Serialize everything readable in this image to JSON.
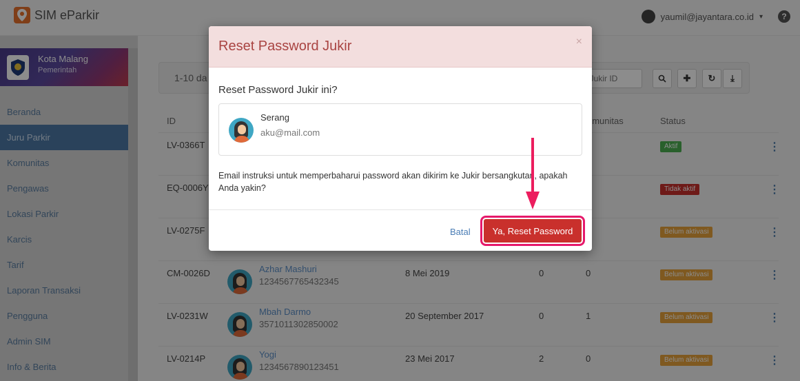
{
  "app": {
    "title": "SIM eParkir"
  },
  "user": {
    "email": "yaumil@jayantara.co.id"
  },
  "org": {
    "name": "Kota Malang",
    "subtitle": "Pemerintah"
  },
  "sidebar": {
    "items": [
      {
        "label": "Beranda"
      },
      {
        "label": "Juru Parkir",
        "active": true
      },
      {
        "label": "Komunitas"
      },
      {
        "label": "Pengawas"
      },
      {
        "label": "Lokasi Parkir"
      },
      {
        "label": "Karcis"
      },
      {
        "label": "Tarif"
      },
      {
        "label": "Laporan Transaksi"
      },
      {
        "label": "Pengguna"
      },
      {
        "label": "Admin SIM"
      },
      {
        "label": "Info & Berita"
      }
    ]
  },
  "toolbar": {
    "count_label": "1-10 da",
    "search_placeholder": "/ Jukir ID",
    "search_icon": "search-icon",
    "add_icon": "plus-icon",
    "refresh_icon": "refresh-icon",
    "download_icon": "download-icon"
  },
  "table": {
    "headers": {
      "id": "ID",
      "komunitas": "omunitas",
      "status": "Status"
    },
    "rows": [
      {
        "id": "LV-0366T",
        "name": "",
        "phone": "",
        "date": "",
        "n1": "",
        "n2": "",
        "status": "Aktif",
        "status_type": "aktif"
      },
      {
        "id": "EQ-0006Y",
        "name": "",
        "phone": "",
        "date": "",
        "n1": "",
        "n2": "",
        "status": "Tidak aktif",
        "status_type": "tidak"
      },
      {
        "id": "LV-0275F",
        "name": "",
        "phone": "",
        "date": "",
        "n1": "",
        "n2": "",
        "status": "Belum aktivasi",
        "status_type": "belum"
      },
      {
        "id": "CM-0026D",
        "name": "Azhar Mashuri",
        "phone": "1234567765432345",
        "date": "8 Mei 2019",
        "n1": "0",
        "n2": "0",
        "status": "Belum aktivasi",
        "status_type": "belum"
      },
      {
        "id": "LV-0231W",
        "name": "Mbah Darmo",
        "phone": "3571011302850002",
        "date": "20 September 2017",
        "n1": "0",
        "n2": "1",
        "status": "Belum aktivasi",
        "status_type": "belum"
      },
      {
        "id": "LV-0214P",
        "name": "Yogi",
        "phone": "1234567890123451",
        "date": "23 Mei 2017",
        "n1": "2",
        "n2": "0",
        "status": "Belum aktivasi",
        "status_type": "belum"
      }
    ]
  },
  "modal": {
    "title": "Reset Password Jukir",
    "close": "×",
    "question": "Reset Password Jukir ini?",
    "jukir_name": "Serang",
    "jukir_email": "aku@mail.com",
    "message": "Email instruksi untuk memperbaharui password akan dikirim ke Jukir bersangkutan, apakah Anda yakin?",
    "cancel_label": "Batal",
    "confirm_label": "Ya, Reset Password"
  },
  "colors": {
    "accent": "#4e79a7",
    "danger": "#c9302c",
    "annotation": "#ec1d5e"
  }
}
